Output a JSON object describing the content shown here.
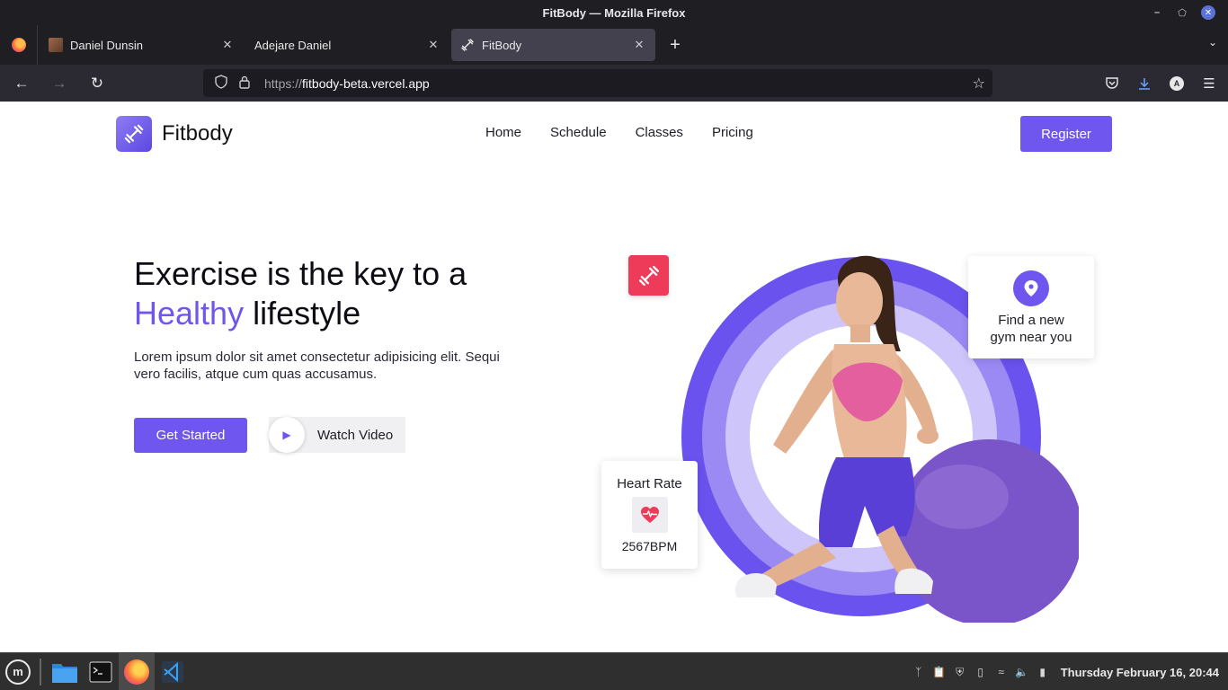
{
  "window": {
    "title": "FitBody — Mozilla Firefox"
  },
  "tabs": [
    {
      "label": "Daniel Dunsin",
      "active": false,
      "favicon": "avatar-photo"
    },
    {
      "label": "Adejare Daniel",
      "active": false,
      "favicon": "none"
    },
    {
      "label": "FitBody",
      "active": true,
      "favicon": "dumbbell-icon"
    }
  ],
  "urlbar": {
    "scheme": "https://",
    "host": "fitbody-beta.vercel.app"
  },
  "site": {
    "brand": "Fitbody",
    "nav": [
      "Home",
      "Schedule",
      "Classes",
      "Pricing"
    ],
    "register": "Register",
    "hero": {
      "title_part1": "Exercise is the key to a",
      "title_accent": "Healthy",
      "title_part2": "lifestyle",
      "description": "Lorem ipsum dolor sit amet consectetur adipisicing elit. Sequi vero facilis, atque cum quas accusamus.",
      "cta_primary": "Get Started",
      "cta_secondary": "Watch Video"
    },
    "gym_card": {
      "line1": "Find a new",
      "line2": "gym near you"
    },
    "heart_card": {
      "title": "Heart Rate",
      "value": "2567BPM"
    }
  },
  "colors": {
    "accent": "#6e56ef",
    "badge_red": "#ee3b5a",
    "firefox_dark": "#1f1e22"
  },
  "taskbar": {
    "clock": "Thursday February 16, 20:44",
    "apps": [
      "files",
      "terminal",
      "firefox",
      "vscode"
    ]
  }
}
